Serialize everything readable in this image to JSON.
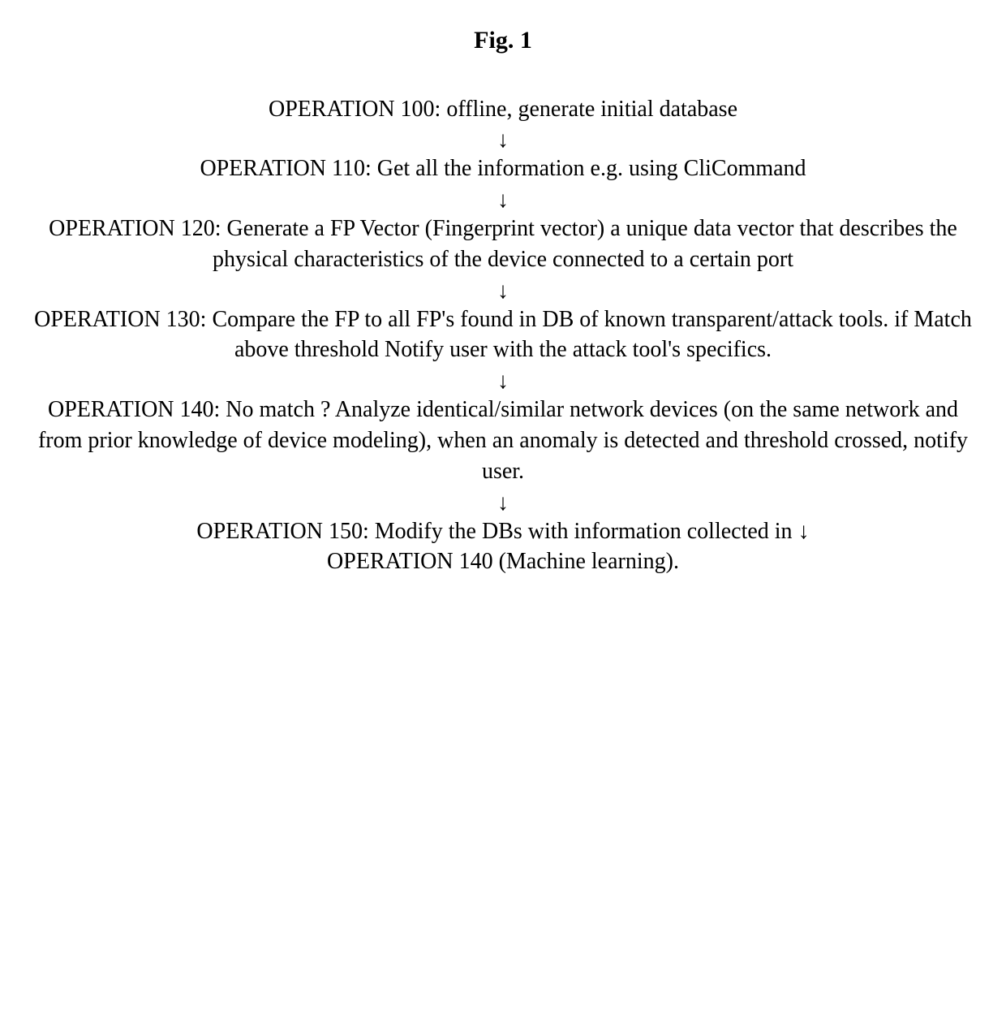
{
  "title": "Fig. 1",
  "steps": {
    "s100": "OPERATION 100: offline, generate initial database",
    "s110": "OPERATION 110: Get all the information e.g. using CliCommand",
    "s120": "OPERATION 120: Generate a FP Vector (Fingerprint vector) a unique data vector that describes the physical characteristics of the device connected to a certain port",
    "s130": "OPERATION 130: Compare the FP to all FP's found in DB of known transparent/attack tools. if Match above threshold Notify user with the attack tool's specifics.",
    "s140": "OPERATION 140: No match ? Analyze identical/similar network devices (on the same network and from prior knowledge of device modeling), when an anomaly is detected and threshold crossed, notify user.",
    "s150a": "OPERATION 150: Modify the DBs with information collected in",
    "s150b": "OPERATION 140 (Machine learning)."
  },
  "arrow": "↓"
}
